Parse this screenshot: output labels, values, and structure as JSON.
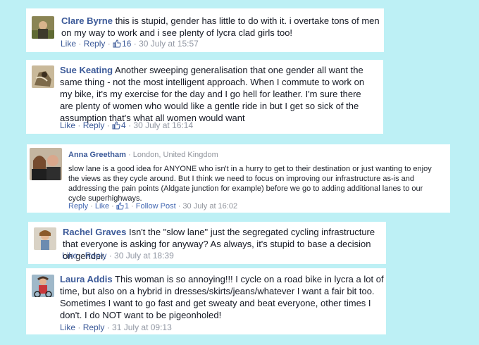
{
  "comments": [
    {
      "author": "Clare Byrne",
      "text": " this is stupid, gender has little to do with it. i overtake tons of men on my way to work and i see plenty of lycra clad girls too!",
      "like_label": "Like",
      "reply_label": "Reply",
      "likes": "16",
      "timestamp": "30 July at 15:57"
    },
    {
      "author": "Sue Keating",
      "text": " Another sweeping generalisation that one gender all want the same thing - not the most intelligent approach. When I commute to work on my bike, it's my exercise for the day and I go hell for leather. I'm sure there are plenty of women who would like a gentle ride in but I get so sick of the assumption that's what all women would want",
      "like_label": "Like",
      "reply_label": "Reply",
      "likes": "4",
      "timestamp": "30 July at 16:14"
    },
    {
      "author": "Anna Greetham",
      "location": "London, United Kingdom",
      "text": "slow lane is a good idea for ANYONE who isn't in a hurry to get to their destination or just wanting to enjoy the views as they cycle around. But I think we need to focus on improving our infrastructure as-is and addressing the pain points (Aldgate junction for example) before we go to adding additional lanes to our cycle superhighways.",
      "reply_label": "Reply",
      "like_label": "Like",
      "likes": "1",
      "follow_label": "Follow Post",
      "timestamp": "30 July at 16:02"
    },
    {
      "author": "Rachel Graves",
      "text": " Isn't the \"slow lane\" just the segregated cycling infrastructure that everyone is asking for anyway? As always, it's stupid to base a decision on gender.",
      "like_label": "Like",
      "reply_label": "Reply",
      "timestamp": "30 July at 18:39"
    },
    {
      "author": "Laura Addis",
      "text": " This woman is so annoying!!! I cycle on a road bike in lycra a lot of time, but also on a hybrid in dresses/skirts/jeans/whatever I want a fair bit too. Sometimes I want to go fast and get sweaty and beat everyone, other times I don't. I do NOT want to be pigeonholed!",
      "like_label": "Like",
      "reply_label": "Reply",
      "timestamp": "31 July at 09:13"
    }
  ],
  "colors": {
    "background": "#bdf0f5",
    "name_link": "#3b5998",
    "meta_grey": "#9197a3"
  },
  "icons": {
    "like_count": "thumbs-up-icon"
  }
}
